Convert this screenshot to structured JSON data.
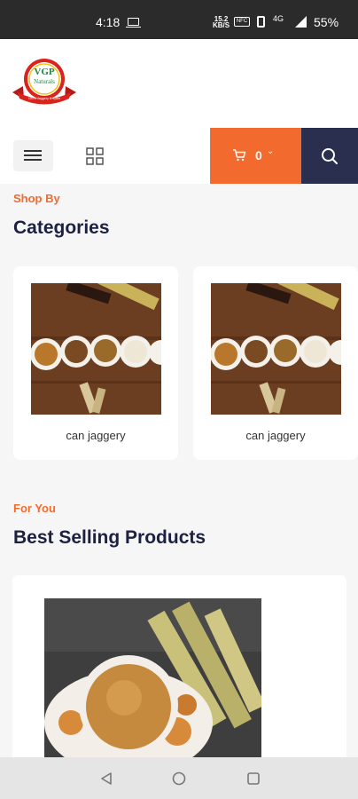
{
  "status_bar": {
    "time": "4:18",
    "speed_value": "15.2",
    "speed_unit": "KB/S",
    "net_indicator": "NFC",
    "wifi_label": "4G",
    "battery": "55%"
  },
  "brand": {
    "logo_top": "VGP",
    "logo_bottom": "Naturals",
    "logo_ribbon": "100% Jaggery & Spice",
    "colors": {
      "red": "#d9231d",
      "green": "#1b8a3c",
      "gold": "#f2c21a"
    }
  },
  "toolbar": {
    "menu_icon": "hamburger-icon",
    "grid_icon": "grid-icon",
    "cart_count": "0",
    "cart_icon": "cart-icon",
    "search_icon": "search-icon",
    "accent": "#f26a2e",
    "navy": "#2b2f4f"
  },
  "categories_section": {
    "eyebrow": "Shop By",
    "title": "Categories",
    "items": [
      {
        "label": "can jaggery"
      },
      {
        "label": "can jaggery"
      }
    ]
  },
  "products_section": {
    "eyebrow": "For You",
    "title": "Best Selling Products"
  },
  "nav_bar": {
    "back_icon": "back-triangle-icon",
    "home_icon": "home-circle-icon",
    "recents_icon": "recents-square-icon"
  }
}
